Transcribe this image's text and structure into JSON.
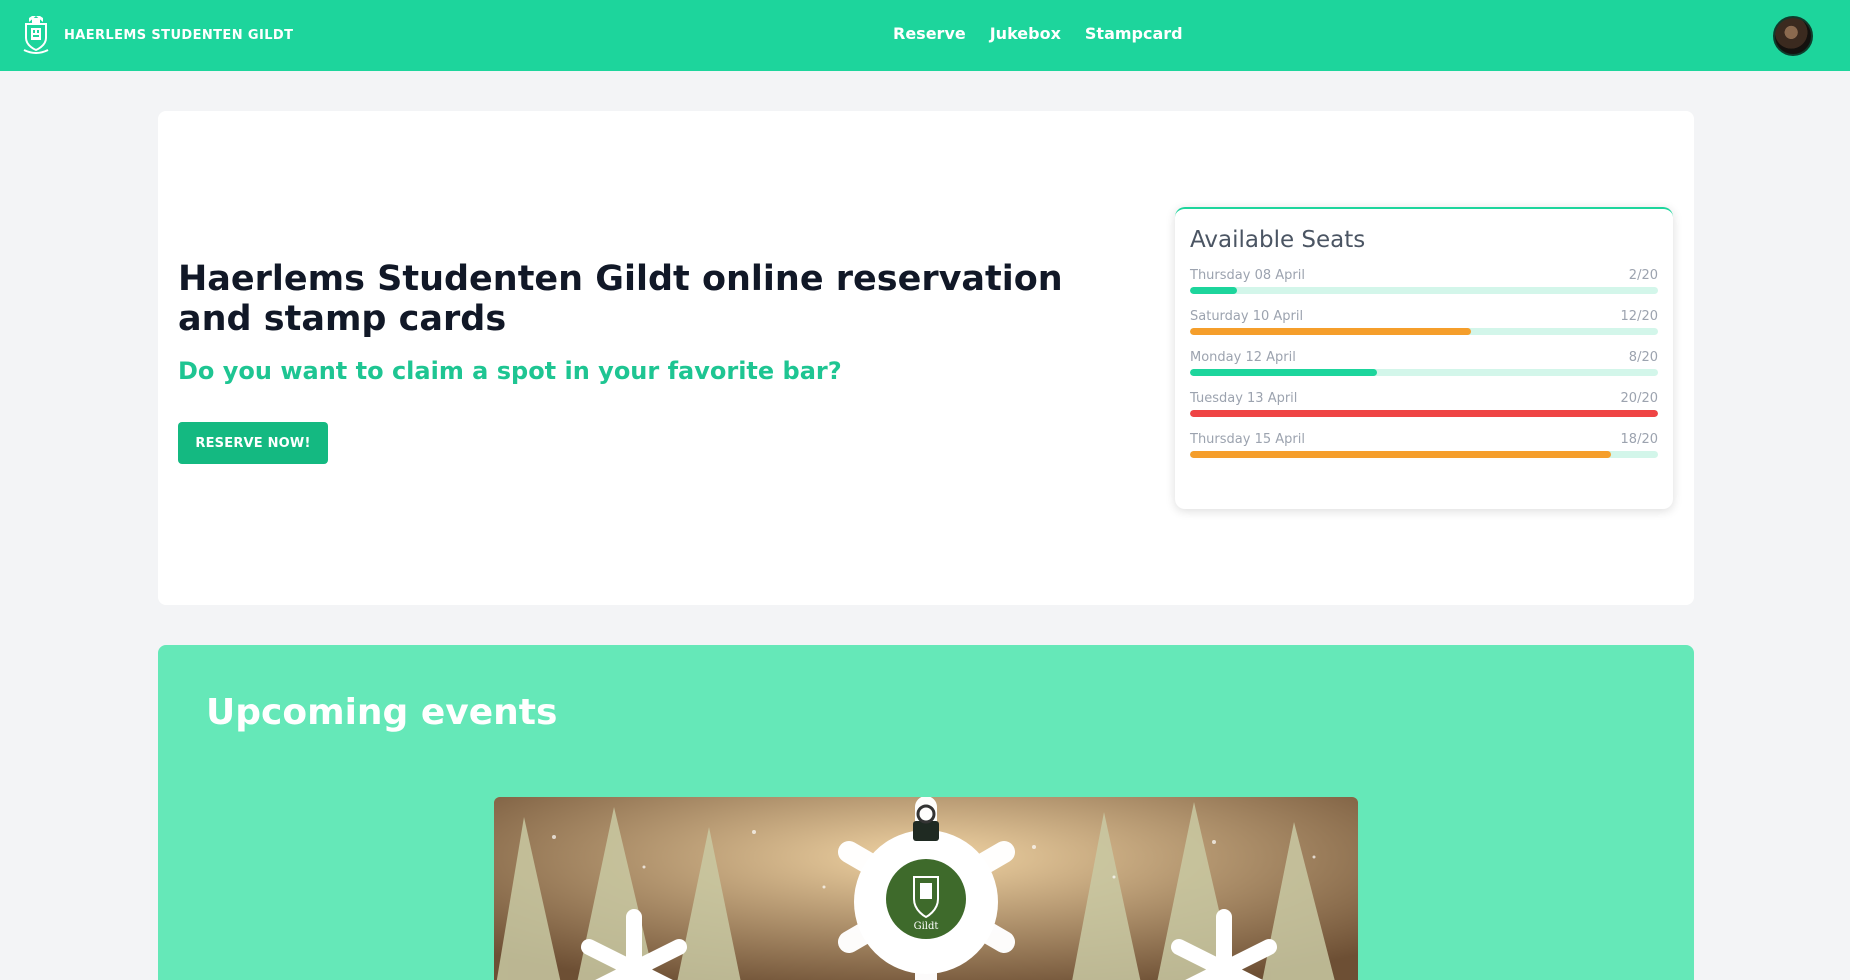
{
  "brand": {
    "title": "HAERLEMS STUDENTEN GILDT"
  },
  "nav": {
    "links": [
      "Reserve",
      "Jukebox",
      "Stampcard"
    ]
  },
  "hero": {
    "title": "Haerlems Studenten Gildt online reservation and stamp cards",
    "subtitle": "Do you want to claim a spot in your favorite bar?",
    "button_label": "RESERVE NOW!"
  },
  "seats": {
    "title": "Available Seats",
    "rows": [
      {
        "date": "Thursday 08 April",
        "count": "2/20",
        "fraction": 0.1,
        "color": "#1dd59c"
      },
      {
        "date": "Saturday 10 April",
        "count": "12/20",
        "fraction": 0.6,
        "color": "#f59e2b"
      },
      {
        "date": "Monday 12 April",
        "count": "8/20",
        "fraction": 0.4,
        "color": "#1dd59c"
      },
      {
        "date": "Tuesday 13 April",
        "count": "20/20",
        "fraction": 1.0,
        "color": "#ef4444"
      },
      {
        "date": "Thursday 15 April",
        "count": "18/20",
        "fraction": 0.9,
        "color": "#f59e2b"
      }
    ]
  },
  "events": {
    "title": "Upcoming events",
    "image_text": "Gildt"
  },
  "colors": {
    "accent": "#1dd59c",
    "button": "#14b981",
    "events_bg": "#65e8b8",
    "subtitle": "#1ec592"
  }
}
